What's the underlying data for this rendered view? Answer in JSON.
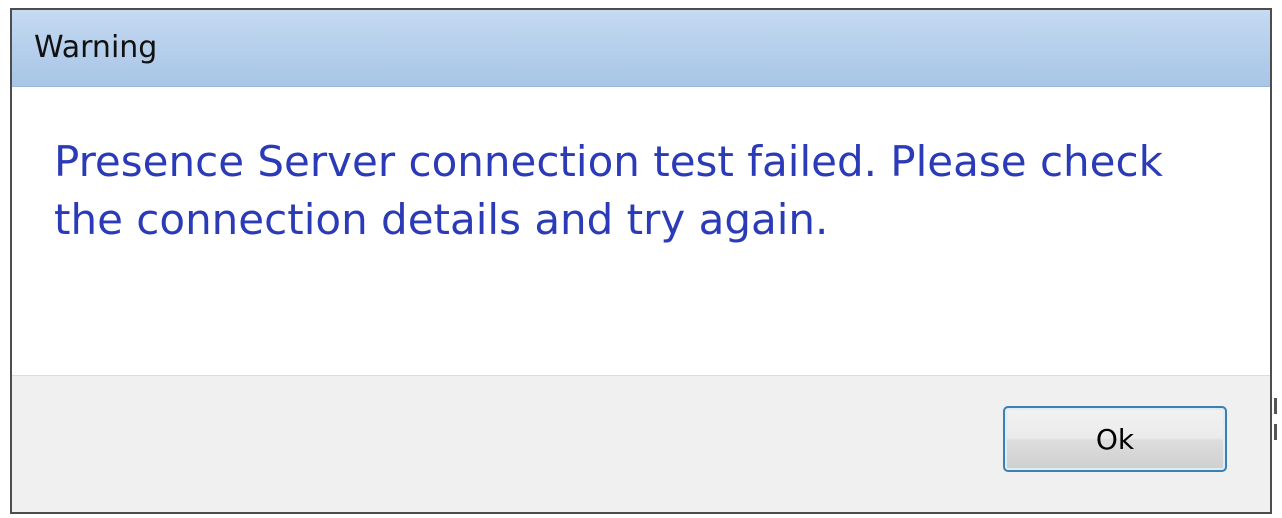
{
  "dialog": {
    "title": "Warning",
    "message": "Presence Server connection test failed. Please check the connection details and try again.",
    "ok_label": "Ok"
  },
  "colors": {
    "title_bar": "#b7d0ec",
    "message_text": "#2b3bb8",
    "footer_bg": "#f0f0f0",
    "button_border": "#3c7fb1"
  }
}
